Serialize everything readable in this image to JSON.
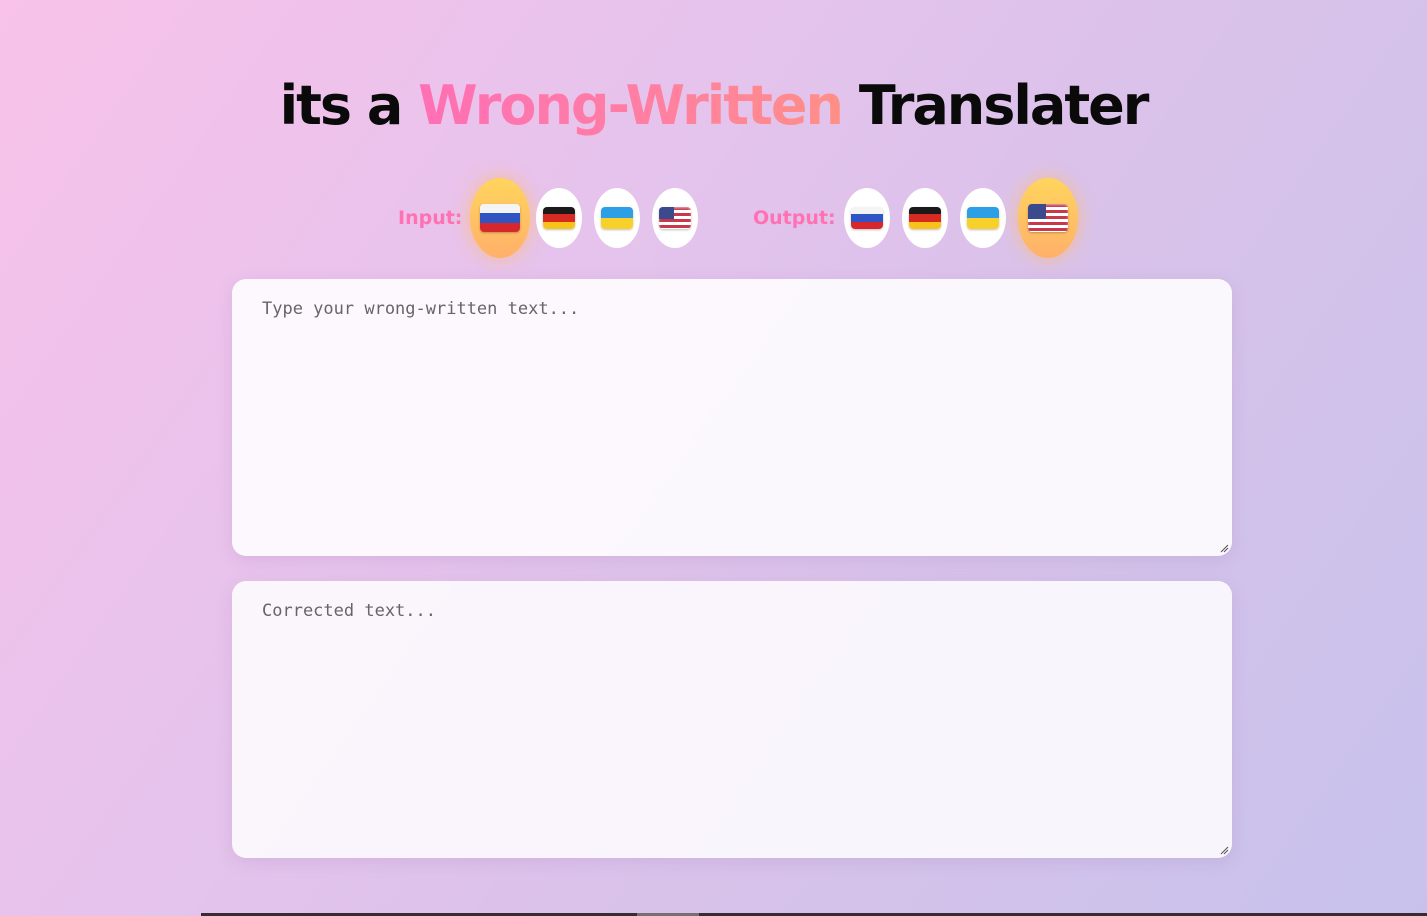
{
  "title": {
    "prefix": "its a",
    "accent": "Wrong-Written",
    "suffix": "Translater"
  },
  "colors": {
    "accent_start": "#ff6fb5",
    "accent_end": "#ff8f86",
    "label": "#ff71b3",
    "active_flag_bg": "#ffc85f"
  },
  "input_langs": {
    "label": "Input:",
    "options": [
      {
        "flag": "russia-flag",
        "active": true
      },
      {
        "flag": "germany-flag",
        "active": false
      },
      {
        "flag": "ukraine-flag",
        "active": false
      },
      {
        "flag": "usa-flag",
        "active": false
      }
    ]
  },
  "output_langs": {
    "label": "Output:",
    "options": [
      {
        "flag": "russia-flag",
        "active": false
      },
      {
        "flag": "germany-flag",
        "active": false
      },
      {
        "flag": "ukraine-flag",
        "active": false
      },
      {
        "flag": "usa-flag",
        "active": true
      }
    ]
  },
  "input_box": {
    "placeholder": "Type your wrong-written text...",
    "value": ""
  },
  "output_box": {
    "placeholder": "Corrected text...",
    "value": ""
  }
}
